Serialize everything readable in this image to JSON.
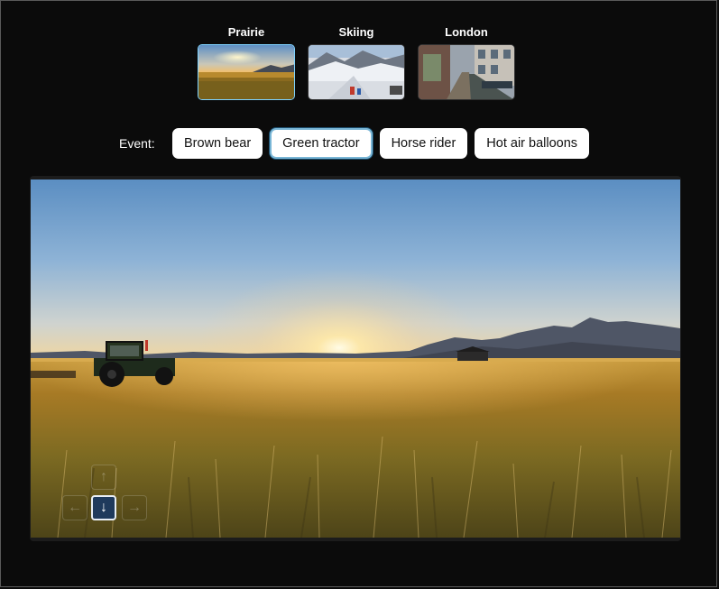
{
  "scenes": [
    {
      "label": "Prairie",
      "selected": true
    },
    {
      "label": "Skiing",
      "selected": false
    },
    {
      "label": "London",
      "selected": false
    }
  ],
  "event": {
    "label": "Event:",
    "options": [
      {
        "label": "Brown bear",
        "selected": false
      },
      {
        "label": "Green tractor",
        "selected": true
      },
      {
        "label": "Horse rider",
        "selected": false
      },
      {
        "label": "Hot air balloons",
        "selected": false
      }
    ]
  },
  "viewer": {
    "scene": "prairie-sunset-with-tractor",
    "arrows": {
      "up": {
        "glyph": "↑",
        "active": false
      },
      "left": {
        "glyph": "←",
        "active": false
      },
      "down": {
        "glyph": "↓",
        "active": true
      },
      "right": {
        "glyph": "→",
        "active": false
      }
    }
  },
  "colors": {
    "selection_border": "#7fd3ff",
    "active_arrow_bg": "#1f3a5c"
  }
}
